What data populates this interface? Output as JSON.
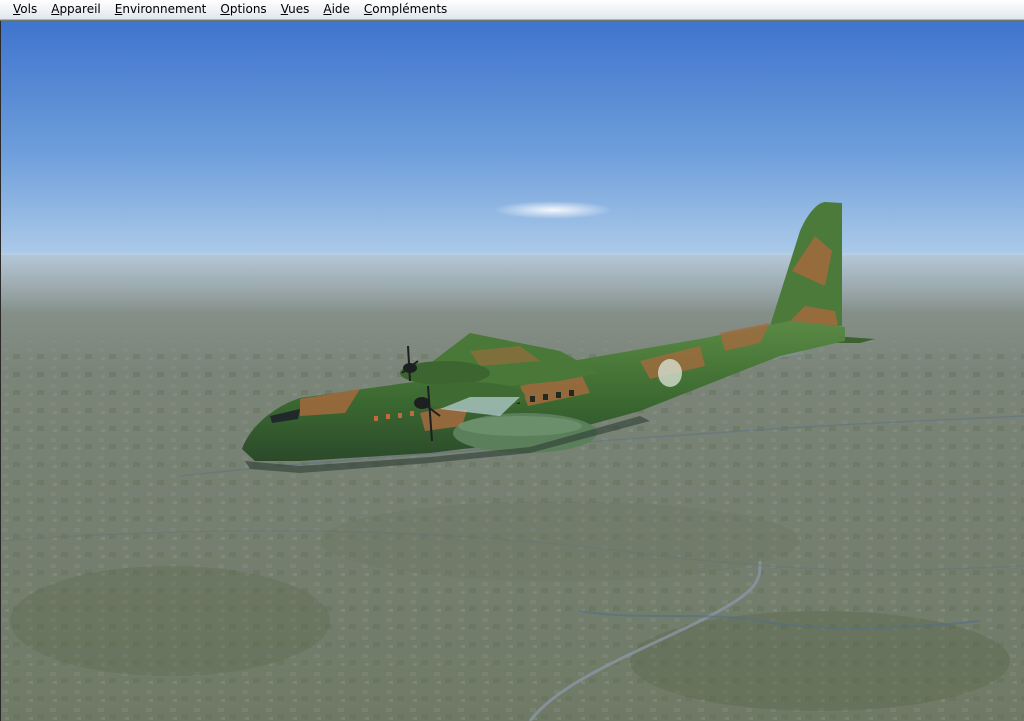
{
  "menu": {
    "items": [
      {
        "label": "Vols"
      },
      {
        "label": "Appareil"
      },
      {
        "label": "Environnement"
      },
      {
        "label": "Options"
      },
      {
        "label": "Vues"
      },
      {
        "label": "Aide"
      },
      {
        "label": "Compléments"
      }
    ]
  },
  "scene": {
    "aircraft": "military transport aircraft, green and brown camouflage",
    "sky_color": "#4a7fcf",
    "horizon_color": "#a9c9e8",
    "ground_color": "#76806f",
    "camo_green": "#3f6b2e",
    "camo_brown": "#a36a3e"
  }
}
